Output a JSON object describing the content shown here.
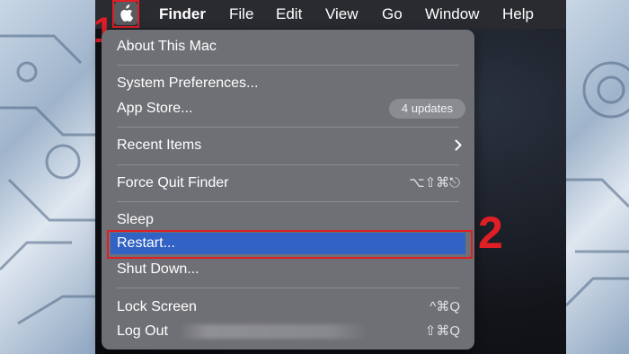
{
  "menubar": {
    "items": [
      "Finder",
      "File",
      "Edit",
      "View",
      "Go",
      "Window",
      "Help"
    ]
  },
  "annotations": {
    "step1": "1",
    "step2": "2"
  },
  "apple_menu": {
    "about": "About This Mac",
    "system_preferences": "System Preferences...",
    "app_store": "App Store...",
    "app_store_badge": "4 updates",
    "recent_items": "Recent Items",
    "force_quit": "Force Quit Finder",
    "force_quit_shortcut": "⌥⇧⌘⎋",
    "sleep": "Sleep",
    "restart": "Restart...",
    "shut_down": "Shut Down...",
    "lock_screen": "Lock Screen",
    "lock_screen_shortcut": "^⌘Q",
    "log_out": "Log Out",
    "log_out_shortcut": "⇧⌘Q"
  },
  "colors": {
    "highlight": "#3162c4",
    "annotation_red": "#e01e26"
  }
}
